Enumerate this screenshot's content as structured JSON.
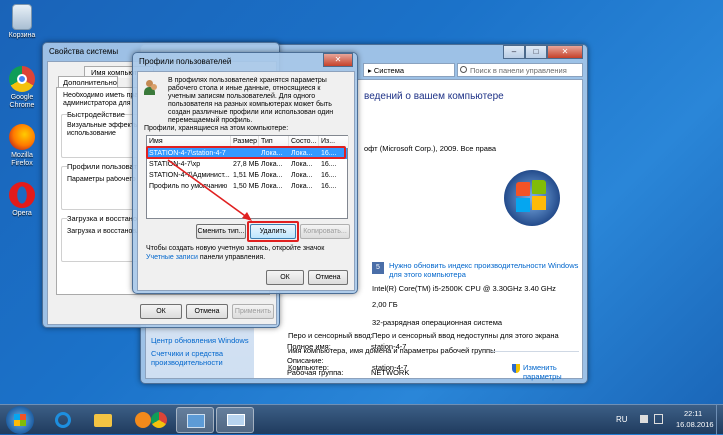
{
  "desktop": {
    "icons": [
      {
        "label": "Корзина"
      },
      {
        "label": "Google Chrome"
      },
      {
        "label": "Mozilla Firefox"
      },
      {
        "label": "Opera"
      }
    ]
  },
  "control_panel": {
    "breadcrumb": "▸ Система",
    "search_placeholder": "Поиск в панели управления",
    "heading": "ведений о вашем компьютере",
    "copyright": "офт (Microsoft Corp.), 2009. Все права",
    "windows_index_link": "Нужно обновить индекс производительности Windows для этого компьютера",
    "rows": [
      {
        "label": "",
        "value": "Intel(R) Core(TM) i5-2500K CPU @ 3.30GHz   3.40 GHz"
      },
      {
        "label": "",
        "value": "2,00 ГБ"
      },
      {
        "label": "",
        "value": "32-разрядная операционная система"
      },
      {
        "label": "Перо и сенсорный ввод:",
        "value": "Перо и сенсорный ввод недоступны для этого экрана"
      }
    ],
    "workgroup_section": "имя компьютера, имя домена и параметры рабочей группы",
    "computer_rows": [
      {
        "label": "Компьютер:",
        "value": "station-4-7"
      },
      {
        "label": "Полное имя:",
        "value": "station-4-7"
      },
      {
        "label": "Описание:",
        "value": ""
      },
      {
        "label": "Рабочая группа:",
        "value": "NETWORK"
      }
    ],
    "change_params_link": "Изменить параметры",
    "sidebar_links": [
      "Центр обновления Windows",
      "Счетчики и средства производительности"
    ]
  },
  "system_props": {
    "title": "Свойства системы",
    "tabs": [
      "Имя компьютера",
      "Дополнительно"
    ],
    "admin_note": "Необходимо иметь права администратора для изменения перечисленных параметров",
    "perf_group": "Быстродействие",
    "perf_text": "Визуальные эффекты, использование процессора, памяти и виртуальной памяти",
    "profiles_group": "Профили пользователей",
    "profiles_text": "Параметры рабочего стола, относящиеся ко входу в систему",
    "startup_group": "Загрузка и восстановление",
    "startup_text": "Загрузка и восстановление системы, отладочная информация",
    "ok": "ОК",
    "cancel": "Отмена",
    "apply": "Применить"
  },
  "profiles_dialog": {
    "title": "Профили пользователей",
    "intro": "В профилях пользователей хранятся параметры рабочего стола и иные данные, относящиеся к учетным записям пользователей. Для одного пользователя на разных компьютерах может быть создан различные профили или использован один перемещаемый профиль.",
    "list_label": "Профили, хранящиеся на этом компьютере:",
    "columns": [
      "Имя",
      "Размер",
      "Тип",
      "Состо...",
      "Из..."
    ],
    "profiles": [
      {
        "name": "STATION-4-7\\station-4-7",
        "size": "",
        "type": "Лока...",
        "status": "Лока...",
        "modified": "16...."
      },
      {
        "name": "STATION-4-7\\xp",
        "size": "27,8 МБ",
        "type": "Лока...",
        "status": "Лока...",
        "modified": "16...."
      },
      {
        "name": "STATION-4-7\\Админист...",
        "size": "1,51 МБ",
        "type": "Лока...",
        "status": "Лока...",
        "modified": "16...."
      },
      {
        "name": "Профиль по умолчанию",
        "size": "1,50 МБ",
        "type": "Лока...",
        "status": "Лока...",
        "modified": "16...."
      }
    ],
    "change_type": "Сменить тип...",
    "delete": "Удалить",
    "copy": "Копировать...",
    "footer_text": "Чтобы создать новую учетную запись, откройте значок",
    "footer_link": "Учетные записи",
    "footer_text2": "панели управления.",
    "ok": "ОК",
    "cancel": "Отмена"
  },
  "taskbar": {
    "lang": "RU",
    "time": "22:11",
    "date": "16.08.2016"
  },
  "colors": {
    "highlight_red": "#e02020",
    "selection_blue": "#3399ff",
    "link_blue": "#0066cc"
  }
}
